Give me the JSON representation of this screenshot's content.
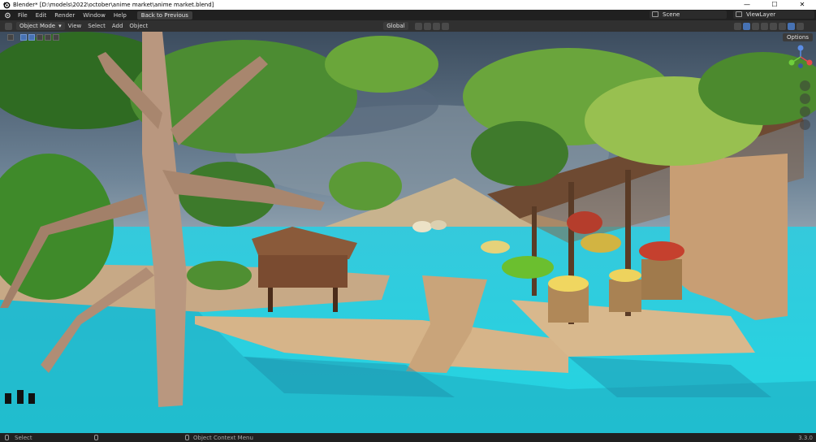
{
  "window": {
    "title": "Blender* [D:\\models\\2022\\october\\anime market\\anime market.blend]",
    "controls": [
      "—",
      "☐",
      "✕"
    ]
  },
  "menubar": {
    "items": [
      "File",
      "Edit",
      "Render",
      "Window",
      "Help"
    ],
    "back_button": "Back to Previous",
    "scene": "Scene",
    "view_layer": "ViewLayer"
  },
  "header": {
    "mode": "Object Mode",
    "menus": [
      "View",
      "Select",
      "Add",
      "Object"
    ],
    "transform_orientation": "Global",
    "options": "Options"
  },
  "status": {
    "left": "Select",
    "middle": "Object Context Menu",
    "version": "3.3.0"
  },
  "colors": {
    "water": "#2fd6e0",
    "sky": "#3e5163",
    "accent": "#4772b3"
  },
  "icons": [
    "blender-logo-icon",
    "mouse-left-icon",
    "mouse-right-icon",
    "axis-gizmo-icon",
    "zoom-icon",
    "pan-hand-icon",
    "camera-icon",
    "grid-icon",
    "playback-icon"
  ]
}
